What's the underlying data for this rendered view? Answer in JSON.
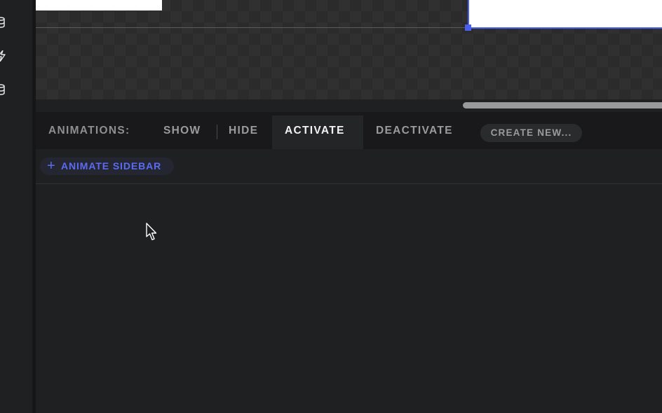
{
  "animations_bar": {
    "label": "ANIMATIONS:",
    "tabs": [
      {
        "label": "SHOW",
        "active": false
      },
      {
        "label": "HIDE",
        "active": false
      },
      {
        "label": "ACTIVATE",
        "active": true
      },
      {
        "label": "DEACTIVATE",
        "active": false
      }
    ],
    "create_new_label": "CREATE NEW..."
  },
  "add_animation": {
    "icon": "plus-icon",
    "label": "ANIMATE SIDEBAR"
  },
  "rail_icons": [
    "database-icon",
    "lightning-icon",
    "database-icon"
  ],
  "colors": {
    "accent": "#4a5ff0",
    "background": "#1f2022",
    "toolbar_bg": "#19191b",
    "active_tab_bg": "#242527",
    "muted_text": "#9b9b9c",
    "active_text": "#f2f2f2"
  }
}
